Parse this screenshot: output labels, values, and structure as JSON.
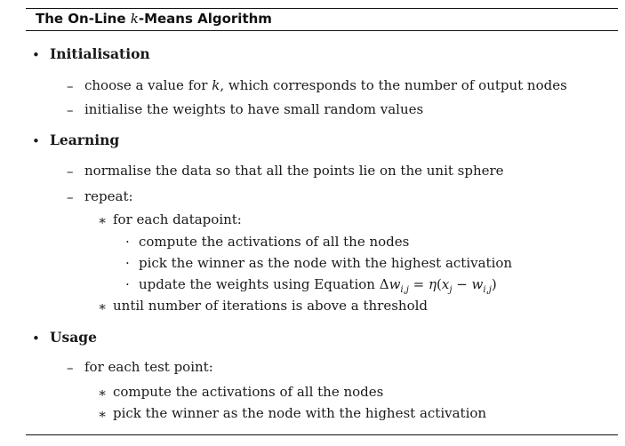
{
  "title": {
    "prefix": "The On-Line ",
    "var": "k",
    "suffix": "-Means Algorithm"
  },
  "markers": {
    "bullet": "•",
    "dash": "–",
    "star": "∗",
    "dot": "·"
  },
  "sections": {
    "initialisation": {
      "heading": "Initialisation",
      "item1_pre": "choose a value for ",
      "item1_var": "k",
      "item1_post": ", which corresponds to the number of output nodes",
      "item2": "initialise the weights to have small random values"
    },
    "learning": {
      "heading": "Learning",
      "item1": "normalise the data so that all the points lie on the unit sphere",
      "item2": "repeat:",
      "for_each": "for each datapoint:",
      "step1": "compute the activations of all the nodes",
      "step2": "pick the winner as the node with the highest activation",
      "step3_pre": "update the weights using Equation ",
      "eq_delta": "Δ",
      "eq_w": "w",
      "eq_sub": "i,j",
      "eq_eq": " = ",
      "eq_eta": "η",
      "eq_paren_open": "(",
      "eq_x": "x",
      "eq_xsub": "j",
      "eq_minus": " − ",
      "eq_w2": "w",
      "eq_sub2": "i,j",
      "eq_paren_close": ")",
      "until": "until number of iterations is above a threshold"
    },
    "usage": {
      "heading": "Usage",
      "item1": "for each test point:",
      "step1": "compute the activations of all the nodes",
      "step2": "pick the winner as the node with the highest activation"
    }
  }
}
